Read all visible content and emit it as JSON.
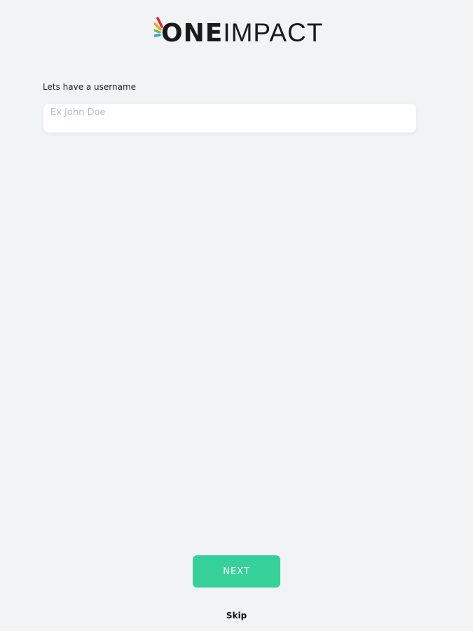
{
  "brand": {
    "name_part1": "ONE",
    "name_part2": "IMPACT",
    "ray_colors": [
      "#e5203a",
      "#f6a21a",
      "#7ac143",
      "#2aa8d8"
    ]
  },
  "form": {
    "username_label": "Lets have a username",
    "username_placeholder": "Ex John Doe",
    "username_value": ""
  },
  "actions": {
    "next_label": "NEXT",
    "skip_label": "Skip",
    "next_color": "#36d19b"
  }
}
